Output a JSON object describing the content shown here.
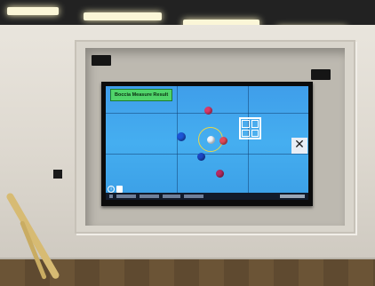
{
  "app": {
    "title": "Boccia Measure Result"
  },
  "controls": {
    "close_symbol": "✕",
    "info_symbol": "i"
  },
  "icons": [
    "grid-view-icon",
    "close-icon",
    "info-icon",
    "save-icon"
  ],
  "colors": {
    "court_blue": "#45aef0",
    "title_badge_green": "#50d46a",
    "jack_white": "#eef6ff",
    "red_ball": "#d93a6a",
    "blue_ball": "#1c55d6",
    "target_ring_yellow": "#e8d84a",
    "taskbar": "#121b2b"
  }
}
